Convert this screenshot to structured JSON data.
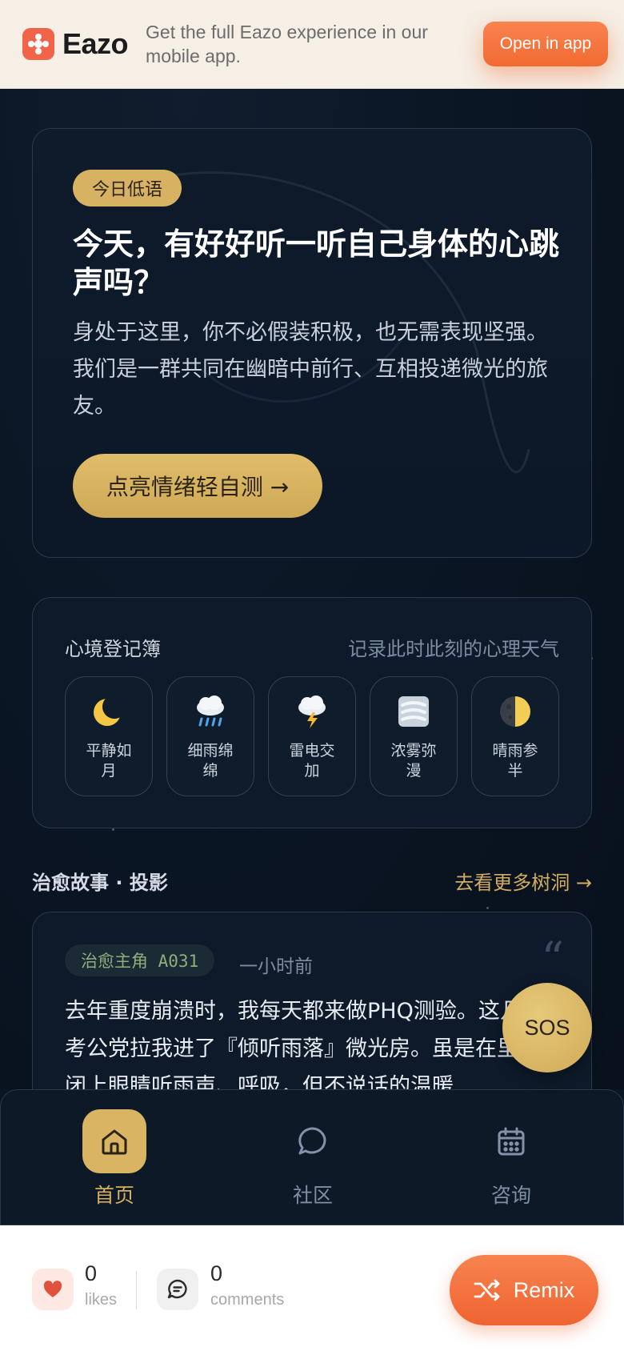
{
  "banner": {
    "brand": "Eazo",
    "message": "Get the full Eazo experience in our mobile app.",
    "open_label": "Open in app"
  },
  "hero": {
    "badge": "今日低语",
    "title": "今天，有好好听一听自己身体的心跳声吗？",
    "body": "身处于这里，你不必假装积极，也无需表现坚强。我们是一群共同在幽暗中前行、互相投递微光的旅友。",
    "cta": "点亮情绪轻自测 →"
  },
  "mood": {
    "title": "心境登记簿",
    "subtitle": "记录此时此刻的心理天气",
    "items": [
      {
        "label": "平静如月",
        "icon": "crescent-moon-icon"
      },
      {
        "label": "细雨绵绵",
        "icon": "rain-cloud-icon"
      },
      {
        "label": "雷电交加",
        "icon": "thunder-cloud-icon"
      },
      {
        "label": "浓雾弥漫",
        "icon": "fog-icon"
      },
      {
        "label": "晴雨参半",
        "icon": "half-moon-icon"
      }
    ]
  },
  "stories": {
    "title": "治愈故事 · 投影",
    "more_link": "去看更多树洞 →",
    "card": {
      "tag": "治愈主角 A031",
      "time": "一小时前",
      "quote": "“",
      "text": "去年重度崩溃时，我每天都来做PHQ测验。这几个考公党拉我进了『倾听雨落』微光房。虽是在里面闭上眼睛听雨声、呼吸，但不说话的温暖"
    }
  },
  "sos_label": "SOS",
  "tabs": [
    {
      "label": "首页",
      "icon": "home-icon",
      "active": true
    },
    {
      "label": "社区",
      "icon": "chat-bubble-icon",
      "active": false
    },
    {
      "label": "咨询",
      "icon": "calendar-icon",
      "active": false
    }
  ],
  "bottom_bar": {
    "likes_count": "0",
    "likes_label": "likes",
    "comments_count": "0",
    "comments_label": "comments",
    "remix_label": "Remix"
  },
  "colors": {
    "accent_gold": "#d7b263",
    "brand_orange": "#f26a32",
    "background": "#0b1624"
  }
}
